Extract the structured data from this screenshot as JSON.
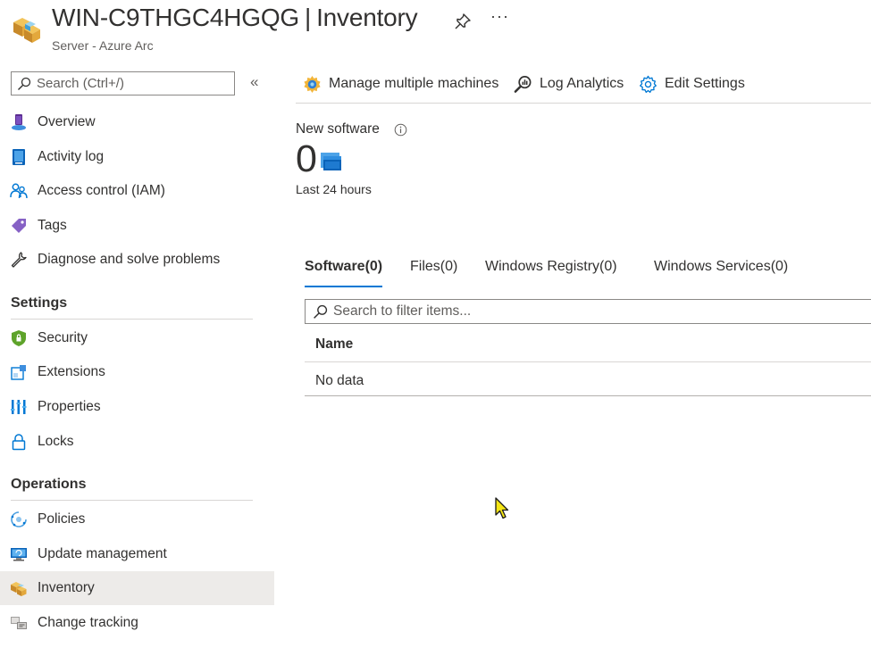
{
  "header": {
    "resource_name": "WIN-C9THGC4HGQG",
    "separator": "|",
    "page": "Inventory",
    "subtitle": "Server - Azure Arc",
    "more_label": "···",
    "icons": {
      "resource": "inventory-box-icon",
      "pin": "pin-icon"
    }
  },
  "sidebar": {
    "search_placeholder": "Search (Ctrl+/)",
    "collapse_label": "«",
    "items_top": [
      {
        "label": "Overview",
        "icon": "overview-icon"
      },
      {
        "label": "Activity log",
        "icon": "activity-log-icon"
      },
      {
        "label": "Access control (IAM)",
        "icon": "people-icon"
      },
      {
        "label": "Tags",
        "icon": "tag-icon"
      },
      {
        "label": "Diagnose and solve problems",
        "icon": "wrench-icon"
      }
    ],
    "settings": {
      "title": "Settings",
      "items": [
        {
          "label": "Security",
          "icon": "shield-icon"
        },
        {
          "label": "Extensions",
          "icon": "extensions-icon"
        },
        {
          "label": "Properties",
          "icon": "properties-icon"
        },
        {
          "label": "Locks",
          "icon": "lock-icon"
        }
      ]
    },
    "operations": {
      "title": "Operations",
      "items": [
        {
          "label": "Policies",
          "icon": "policy-icon"
        },
        {
          "label": "Update management",
          "icon": "update-icon"
        },
        {
          "label": "Inventory",
          "icon": "inventory-icon",
          "active": true
        },
        {
          "label": "Change tracking",
          "icon": "change-tracking-icon"
        }
      ]
    }
  },
  "toolbar": {
    "manage_label": "Manage multiple machines",
    "log_label": "Log Analytics",
    "settings_label": "Edit Settings"
  },
  "metric": {
    "label": "New software",
    "value": "0",
    "period": "Last 24 hours"
  },
  "tabs": [
    {
      "label": "Software(0)",
      "active": true
    },
    {
      "label": "Files(0)"
    },
    {
      "label": "Windows Registry(0)"
    },
    {
      "label": "Windows Services(0)"
    }
  ],
  "filter": {
    "placeholder": "Search to filter items..."
  },
  "table": {
    "columns": [
      "Name"
    ],
    "empty_text": "No data"
  },
  "colors": {
    "accent": "#0078d4",
    "active_bg": "#edebe9",
    "text": "#323130"
  }
}
